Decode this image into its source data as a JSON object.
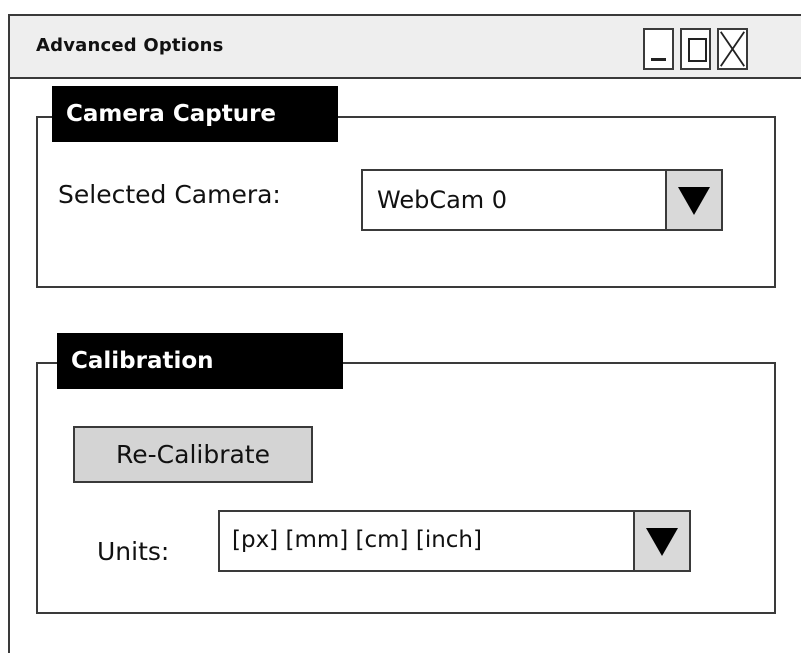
{
  "window": {
    "title": "Advanced Options",
    "controls": {
      "minimize_icon": "minimize-icon",
      "maximize_icon": "maximize-icon",
      "close_icon": "close-icon"
    }
  },
  "camera_capture": {
    "legend": "Camera Capture",
    "selected_camera_label": "Selected Camera:",
    "selected_camera_value": "WebCam 0",
    "dropdown_icon": "triangle-down-icon"
  },
  "calibration": {
    "legend": "Calibration",
    "recalibrate_button": "Re-Calibrate",
    "units_label": "Units:",
    "units_value": "[px] [mm] [cm] [inch]",
    "dropdown_icon": "triangle-down-icon"
  },
  "colors": {
    "legend_background": "#000000",
    "legend_text": "#ffffff",
    "button_background": "#d4d4d4",
    "dropdown_arrow_background": "#d9d9d9",
    "titlebar_background": "#eeeeee"
  }
}
